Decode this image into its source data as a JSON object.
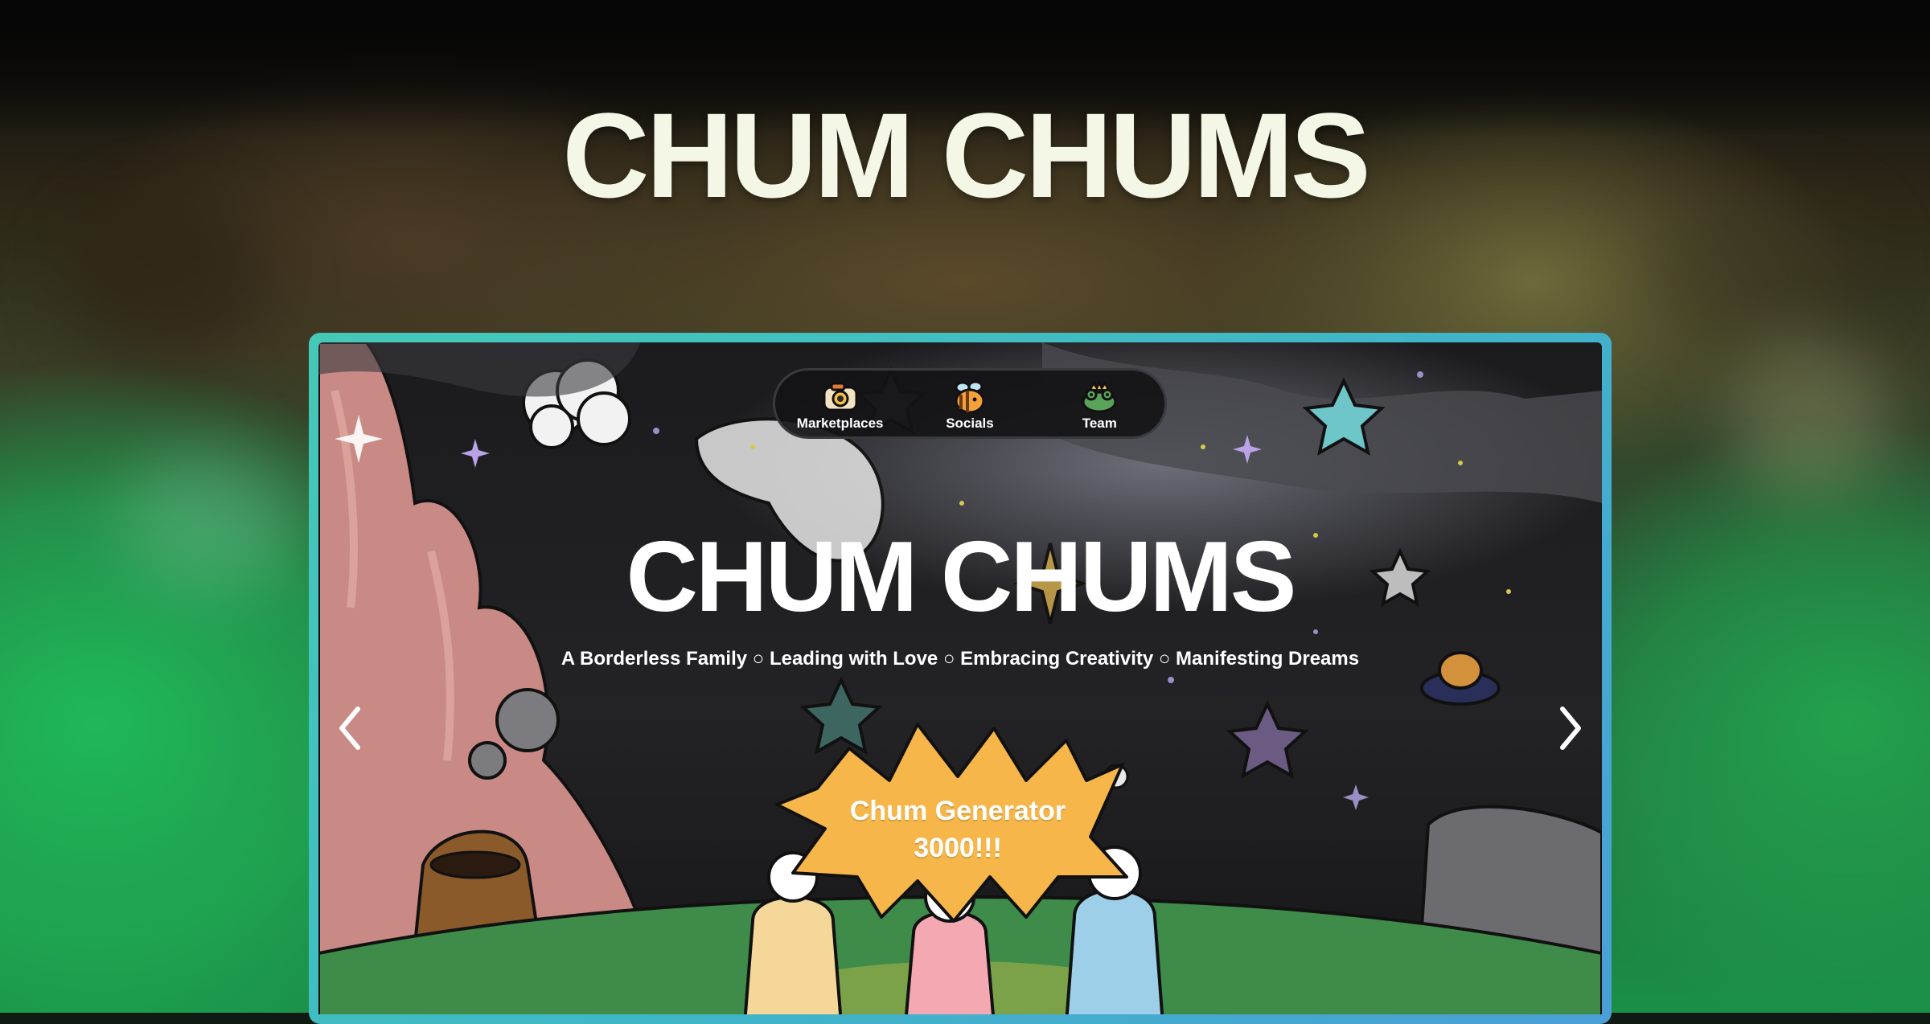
{
  "page": {
    "title": "CHUM CHUMS"
  },
  "nav": {
    "items": [
      {
        "label": "Marketplaces",
        "icon": "camera-icon"
      },
      {
        "label": "Socials",
        "icon": "bee-icon"
      },
      {
        "label": "Team",
        "icon": "frog-icon"
      }
    ]
  },
  "hero": {
    "title": "CHUM CHUMS",
    "tagline": "A Borderless Family ○ Leading with Love ○ Embracing Creativity ○ Manifesting Dreams"
  },
  "generator": {
    "line1": "Chum Generator",
    "line2": "3000!!!"
  },
  "carousel": {
    "prev_icon": "chevron-left-icon",
    "next_icon": "chevron-right-icon"
  },
  "colors": {
    "frame_border": "#45c8b8",
    "generator_bg": "#f6b64a",
    "title_text": "#f4f7e6",
    "nav_bg": "#141416"
  }
}
